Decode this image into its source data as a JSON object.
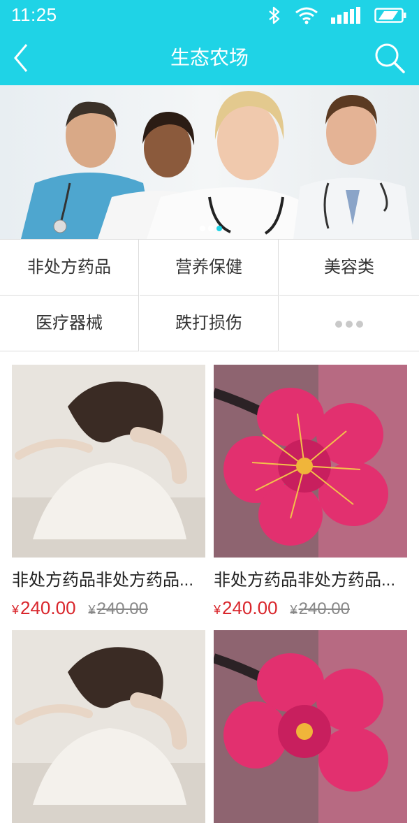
{
  "status_bar": {
    "time": "11:25"
  },
  "header": {
    "title": "生态农场"
  },
  "categories": [
    {
      "label": "非处方药品"
    },
    {
      "label": "营养保健"
    },
    {
      "label": "美容类"
    },
    {
      "label": "医疗器械"
    },
    {
      "label": "跌打损伤"
    },
    {
      "label": "more"
    }
  ],
  "products": [
    {
      "name": "非处方药品非处方药品...",
      "currency": "¥",
      "price": "240.00",
      "old_price": "240.00",
      "image": "woman-photo"
    },
    {
      "name": "非处方药品非处方药品...",
      "currency": "¥",
      "price": "240.00",
      "old_price": "240.00",
      "image": "flower-photo"
    },
    {
      "name": "",
      "currency": "",
      "price": "",
      "old_price": "",
      "image": "woman-photo"
    },
    {
      "name": "",
      "currency": "",
      "price": "",
      "old_price": "",
      "image": "flower-photo"
    }
  ],
  "colors": {
    "accent": "#1fd3e6",
    "price": "#d9262c"
  }
}
